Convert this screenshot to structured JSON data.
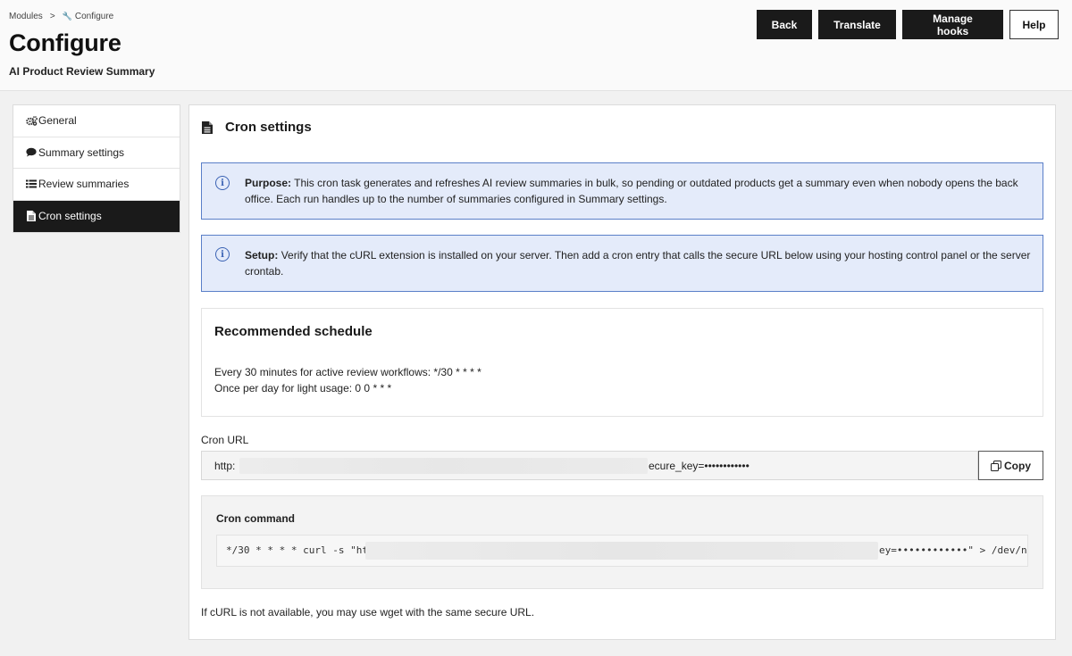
{
  "breadcrumb": {
    "root": "Modules",
    "separator": ">",
    "current": "Configure"
  },
  "header": {
    "title": "Configure",
    "subtitle": "AI Product Review Summary"
  },
  "toolbar": {
    "back": "Back",
    "translate": "Translate",
    "manage_hooks": "Manage hooks",
    "help": "Help"
  },
  "sidebar": {
    "items": [
      {
        "label": "General",
        "icon": "gears-icon",
        "active": false
      },
      {
        "label": "Summary settings",
        "icon": "comment-icon",
        "active": false
      },
      {
        "label": "Review summaries",
        "icon": "list-icon",
        "active": false
      },
      {
        "label": "Cron settings",
        "icon": "file-icon",
        "active": true
      }
    ]
  },
  "main": {
    "title": "Cron settings",
    "purpose": {
      "label": "Purpose:",
      "text": "This cron task generates and refreshes AI review summaries in bulk, so pending or outdated products get a summary even when nobody opens the back office. Each run handles up to the number of summaries configured in Summary settings."
    },
    "setup": {
      "label": "Setup:",
      "text": "Verify that the cURL extension is installed on your server. Then add a cron entry that calls the secure URL below using your hosting control panel or the server crontab."
    },
    "schedule": {
      "title": "Recommended schedule",
      "line1": "Every 30 minutes for active review workflows: */30 * * * *",
      "line2": "Once per day for light usage: 0 0 * * *"
    },
    "cron_url": {
      "label": "Cron URL",
      "prefix": "http:",
      "suffix": "ecure_key=••••••••••••",
      "copy_label": "Copy"
    },
    "cron_command": {
      "label": "Cron command",
      "prefix": "*/30 * * * * curl -s \"ht",
      "suffix": "ey=••••••••••••\" > /dev/n"
    },
    "footnote": "If cURL is not available, you may use wget with the same secure URL."
  },
  "colors": {
    "primary_dark": "#1a1a1a",
    "alert_bg": "#e4ebfa",
    "alert_border": "#5a7fc8",
    "alert_icon": "#3b63b4"
  }
}
